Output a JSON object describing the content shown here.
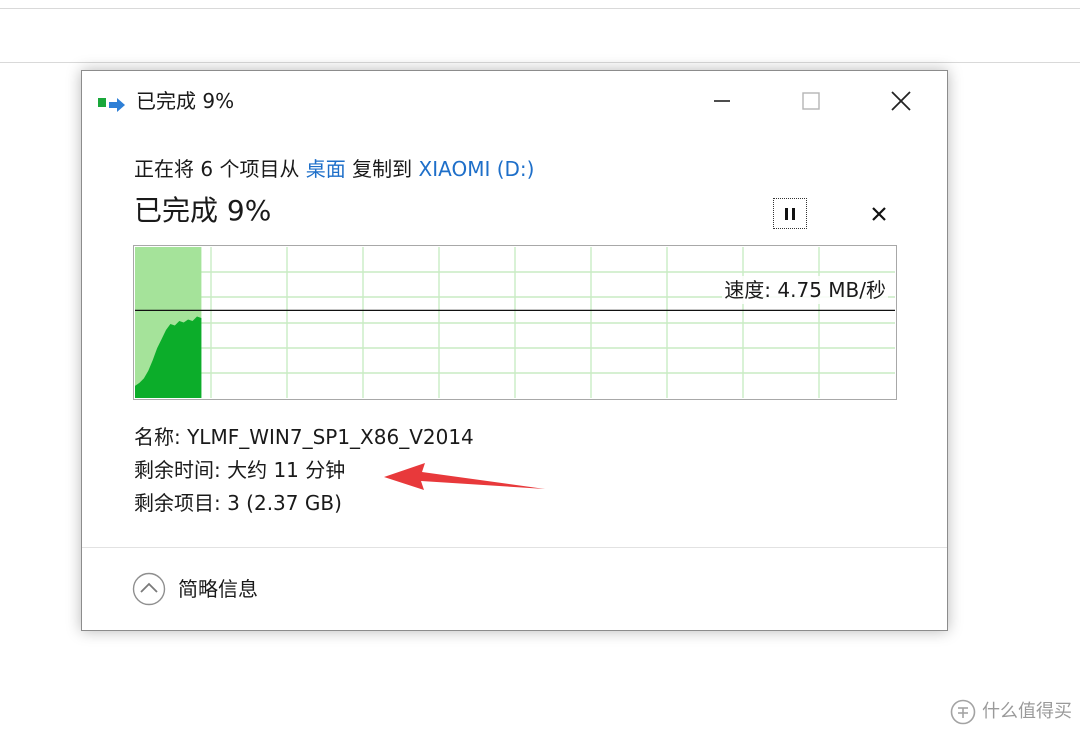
{
  "window": {
    "title": "已完成 9%",
    "controls": {
      "minimize": "minimize-icon",
      "maximize": "maximize-icon",
      "close": "close-icon"
    }
  },
  "copy": {
    "prefix": "正在将 6 个项目从 ",
    "source": "桌面",
    "middle": " 复制到 ",
    "destination": "XIAOMI (D:)",
    "status": "已完成 9%",
    "progress_percent": 9
  },
  "graph": {
    "speed_label": "速度: 4.75 MB/秒",
    "progress_fraction": 0.09,
    "speed_line_fraction": 0.58,
    "fill_color": "#a5e39a",
    "speed_area_color": "#0cad2a",
    "grid_color": "#c9ecc4",
    "samples": [
      0.08,
      0.1,
      0.13,
      0.18,
      0.25,
      0.33,
      0.39,
      0.45,
      0.49,
      0.48,
      0.51,
      0.5,
      0.52,
      0.51,
      0.54,
      0.53
    ]
  },
  "details": {
    "name": "名称: YLMF_WIN7_SP1_X86_V2014",
    "time_remaining": "剩余时间: 大约 11 分钟",
    "items_remaining": "剩余项目: 3 (2.37 GB)"
  },
  "footer": {
    "toggle_label": "简略信息"
  },
  "annotation": {
    "color": "#e8393b"
  },
  "watermark": {
    "text": "什么值得买"
  },
  "colors": {
    "link": "#1e6fc9"
  }
}
